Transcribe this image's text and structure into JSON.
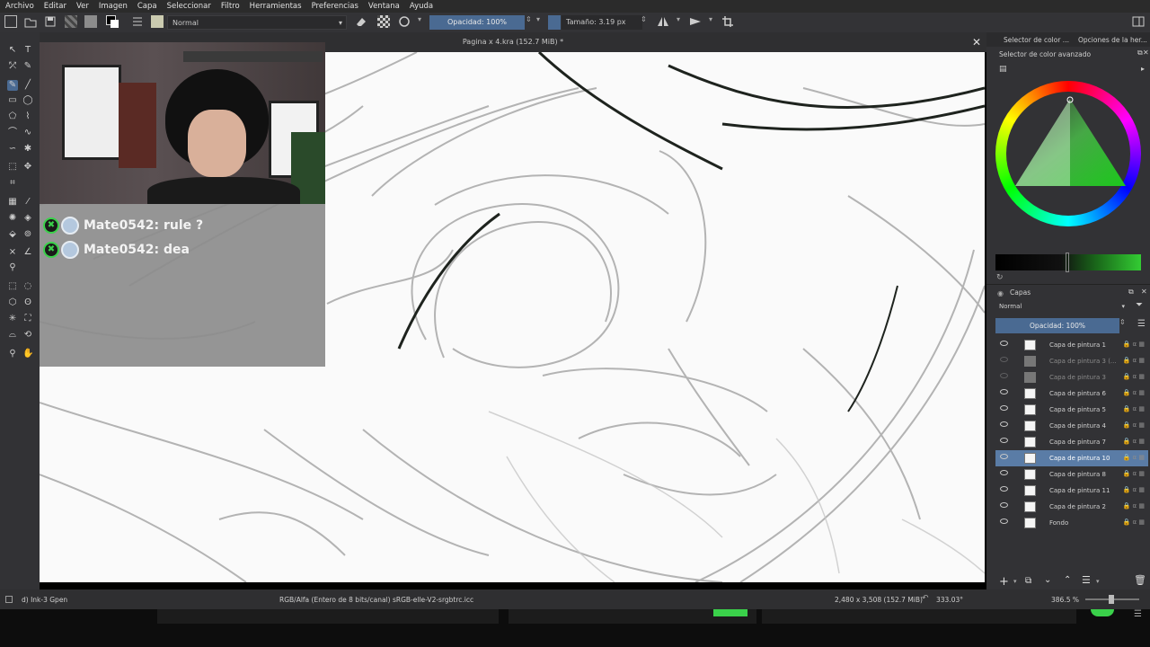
{
  "menu": [
    "Archivo",
    "Editar",
    "Ver",
    "Imagen",
    "Capa",
    "Seleccionar",
    "Filtro",
    "Herramientas",
    "Preferencias",
    "Ventana",
    "Ayuda"
  ],
  "toolbar": {
    "blend_mode": "Normal",
    "opacity_label": "Opacidad: 100%",
    "size_label": "Tamaño: 3.19 px"
  },
  "document": {
    "title": "Pagina x 4.kra (152.7 MiB) *"
  },
  "chat": {
    "messages": [
      {
        "user": "Mate0542",
        "text": "rule ?"
      },
      {
        "user": "Mate0542",
        "text": "dea"
      }
    ],
    "rendered": [
      "Mate0542: rule ?",
      "Mate0542: dea"
    ]
  },
  "dock": {
    "tab1": "Selector de color ...",
    "tab2": "Opciones de la her...",
    "color_panel_title": "Selector de color avanzado",
    "layers_title": "Capas",
    "layers_blend": "Normal",
    "layers_opacity": "Opacidad:  100%",
    "layers": [
      {
        "name": "Capa de pintura 1",
        "visible": true,
        "selected": false
      },
      {
        "name": "Capa de pintura 3 (...",
        "visible": false,
        "selected": false
      },
      {
        "name": "Capa de pintura 3",
        "visible": false,
        "selected": false
      },
      {
        "name": "Capa de pintura 6",
        "visible": true,
        "selected": false
      },
      {
        "name": "Capa de pintura 5",
        "visible": true,
        "selected": false
      },
      {
        "name": "Capa de pintura 4",
        "visible": true,
        "selected": false
      },
      {
        "name": "Capa de pintura 7",
        "visible": true,
        "selected": false
      },
      {
        "name": "Capa de pintura 10",
        "visible": true,
        "selected": true
      },
      {
        "name": "Capa de pintura 8",
        "visible": true,
        "selected": false
      },
      {
        "name": "Capa de pintura 11",
        "visible": true,
        "selected": false
      },
      {
        "name": "Capa de pintura 2",
        "visible": true,
        "selected": false
      },
      {
        "name": "Fondo",
        "visible": true,
        "selected": false
      }
    ]
  },
  "status": {
    "brush": "d) Ink-3 Gpen",
    "color_space": "RGB/Alfa (Entero de 8 bits/canal)  sRGB-elle-V2-srgbtrc.icc",
    "dimensions": "2,480 x 3,508 (152.7 MiB)",
    "rotation": "333.03°",
    "zoom": "386.5 %"
  },
  "colors": {
    "accent": "#4a6a92",
    "panel": "#323235",
    "chat_badge": "#3ad14a"
  }
}
